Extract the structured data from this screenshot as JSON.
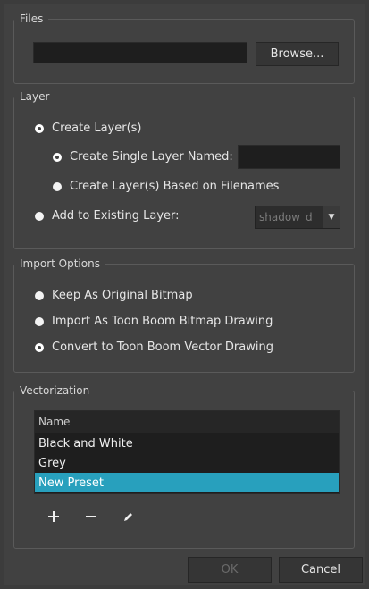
{
  "files": {
    "legend": "Files",
    "path_value": "",
    "browse_label": "Browse..."
  },
  "layer": {
    "legend": "Layer",
    "create_layers": {
      "label": "Create Layer(s)",
      "selected": true
    },
    "create_single": {
      "label": "Create Single Layer Named:",
      "selected": true,
      "name_value": ""
    },
    "create_based": {
      "label": "Create Layer(s) Based on Filenames",
      "selected": false
    },
    "add_existing": {
      "label": "Add to Existing Layer:",
      "selected": false,
      "combo_value": "shadow_d"
    }
  },
  "import_options": {
    "legend": "Import Options",
    "options": [
      {
        "label": "Keep As Original Bitmap",
        "selected": false
      },
      {
        "label": "Import As Toon Boom Bitmap Drawing",
        "selected": false
      },
      {
        "label": "Convert to Toon Boom Vector Drawing",
        "selected": true
      }
    ]
  },
  "vectorization": {
    "legend": "Vectorization",
    "column_header": "Name",
    "presets": [
      {
        "label": "Black and White",
        "selected": false
      },
      {
        "label": "Grey",
        "selected": false
      },
      {
        "label": "New Preset",
        "selected": true
      }
    ],
    "add_icon": "plus-icon",
    "remove_icon": "minus-icon",
    "edit_icon": "pencil-icon"
  },
  "footer": {
    "ok_label": "OK",
    "cancel_label": "Cancel"
  },
  "colors": {
    "selection": "#28a0bd",
    "background": "#414141"
  }
}
